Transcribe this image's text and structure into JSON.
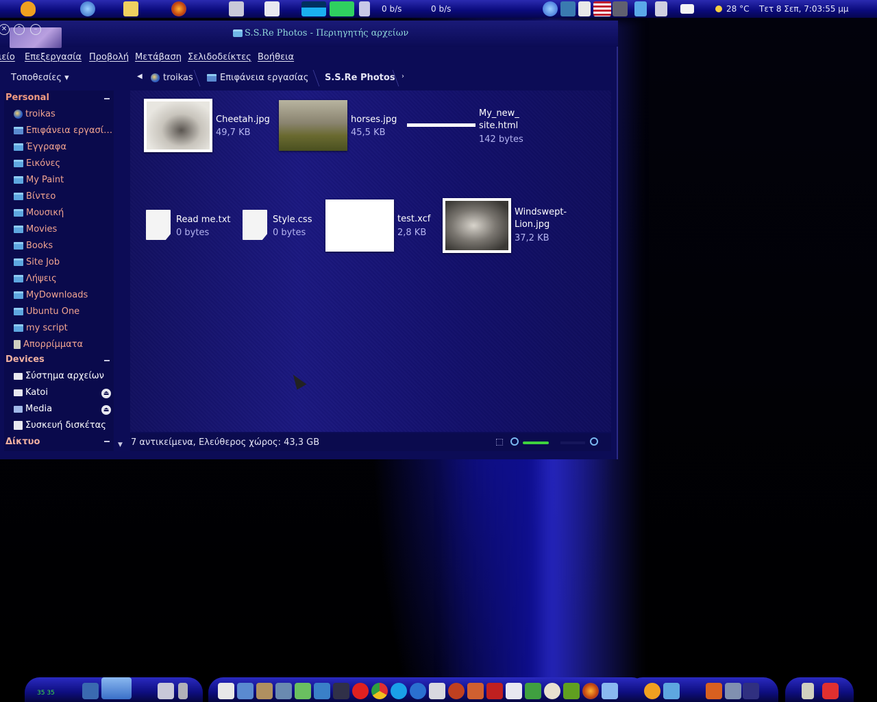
{
  "top_panel": {
    "net_down": "0 b/s",
    "net_up": "0 b/s",
    "weather": "28 °C",
    "clock": "Τετ  8 Σεπ,  7:03:55 μμ"
  },
  "window": {
    "title": "S.S.Re Photos - Περιηγητής αρχείων",
    "menu": [
      "ιείο",
      "Επεξεργασία",
      "Προβολή",
      "Μετάβαση",
      "Σελιδοδείκτες",
      "Βοήθεια"
    ],
    "places_label": "Τοποθεσίες ▾",
    "breadcrumbs": [
      "troikas",
      "Επιφάνεια εργασίας",
      "S.S.Re Photos"
    ]
  },
  "sidebar": {
    "personal_header": "Personal",
    "personal": [
      "troikas",
      "Επιφάνεια εργασί…",
      "Έγγραφα",
      "Εικόνες",
      "My Paint",
      "Βίντεο",
      "Μουσική",
      "Movies",
      "Books",
      "Site Job",
      "Λήψεις",
      "MyDownloads",
      "Ubuntu One",
      "my script",
      "Απορρίμματα"
    ],
    "devices_header": "Devices",
    "devices": [
      "Σύστημα αρχείων",
      "Katoi",
      "Media",
      "Συσκευή δισκέτας"
    ],
    "network_header": "Δίκτυο"
  },
  "files": [
    {
      "name": "Cheetah.jpg",
      "size": "49,7 KB"
    },
    {
      "name": "horses.jpg",
      "size": "45,5 KB"
    },
    {
      "name1": "My_new_",
      "name2": "site.html",
      "size": "142 bytes"
    },
    {
      "name": "Read me.txt",
      "size": "0 bytes"
    },
    {
      "name": "Style.css",
      "size": "0 bytes"
    },
    {
      "name": "test.xcf",
      "size": "2,8 KB"
    },
    {
      "name1": "Windswept-",
      "name2": "Lion.jpg",
      "size": "37,2 KB"
    }
  ],
  "status": {
    "text": "7 αντικείμενα, Ελεύθερος χώρος: 43,3 GB"
  },
  "dock": {
    "clock_label": "35 35"
  },
  "colors": {
    "sidebar_text": "#f2a490",
    "title_text": "#8fd6d8",
    "panel_blue": "#0a0a7a",
    "file_size": "#b4b4f0"
  }
}
